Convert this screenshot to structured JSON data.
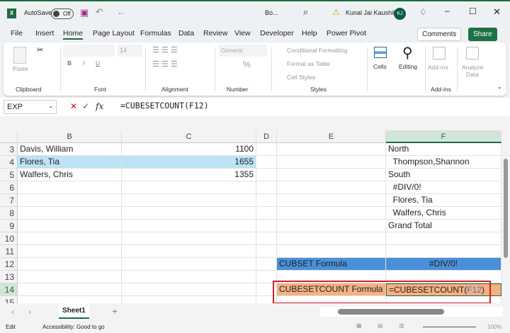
{
  "title_bar": {
    "autosave_label": "AutoSave",
    "autosave_state": "Off",
    "filename": "Bo...",
    "user_name": "Kunal Jai Kaushik",
    "user_initials": "KJ"
  },
  "menu": {
    "tabs": [
      "File",
      "Insert",
      "Home",
      "Page Layout",
      "Formulas",
      "Data",
      "Review",
      "View",
      "Developer",
      "Help",
      "Power Pivot"
    ],
    "active": "Home",
    "comments_label": "Comments",
    "share_label": "Share"
  },
  "ribbon": {
    "paste": "Paste",
    "clipboard": "Clipboard",
    "font_size": "14",
    "font": "Font",
    "alignment": "Alignment",
    "number_format": "General",
    "number": "Number",
    "conditional_formatting": "Conditional Formatting",
    "format_as_table": "Format as Table",
    "cell_styles": "Cell Styles",
    "styles": "Styles",
    "cells": "Cells",
    "editing": "Editing",
    "addins": "Add-ins",
    "analyze_data": "Analyze Data",
    "addins_group": "Add-ins"
  },
  "formula_bar": {
    "name_box": "EXP",
    "fx": "fx",
    "formula": "=CUBESETCOUNT(F12)"
  },
  "columns": [
    "B",
    "C",
    "D",
    "E",
    "F"
  ],
  "rows": [
    "3",
    "4",
    "5",
    "6",
    "7",
    "8",
    "9",
    "10",
    "11",
    "12",
    "13",
    "14",
    "15"
  ],
  "cells": {
    "B3": "Davis, William",
    "C3": "1100",
    "B4": "Flores, Tia",
    "C4": "1655",
    "B5": "Walfers, Chris",
    "C5": "1355",
    "F3": "North",
    "F4": "  Thompson,Shannon",
    "F5": "South",
    "F6": "  #DIV/0!",
    "F7": "  Flores, Tia",
    "F8": "  Walfers, Chris",
    "F9": "Grand Total",
    "E12": "CUBSET Formula",
    "F12": "#DIV/0!",
    "E14": "CUBESETCOUNT Formula",
    "F14_prefix": "=CUBESETCOUNT(",
    "F14_ref": "F12",
    "F14_suffix": ")"
  },
  "colors": {
    "blue_fill": "#4a90d9",
    "light_blue_fill": "#bde3f5",
    "orange_fill": "#f4b183",
    "highlight_border": "#d0202a",
    "ref_color": "#4b6fd6",
    "excel_green": "#1e6b41"
  },
  "sheet_tabs": {
    "active": "Sheet1"
  },
  "status_bar": {
    "mode": "Edit",
    "accessibility": "Accessibility: Good to go",
    "zoom": "100%"
  }
}
